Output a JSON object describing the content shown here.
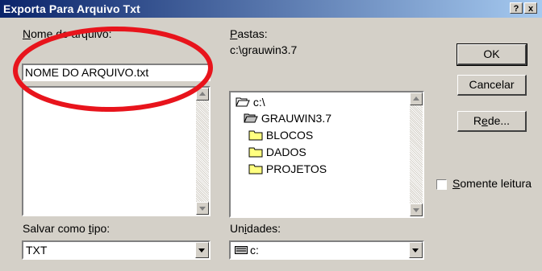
{
  "window": {
    "title": "Exporta Para Arquivo Txt",
    "help_glyph": "?",
    "close_glyph": "x"
  },
  "filename": {
    "label_first": "N",
    "label_rest": "ome do arquivo:",
    "value": "NOME DO ARQUIVO.txt"
  },
  "folders": {
    "label_first": "P",
    "label_rest": "astas:",
    "current_path": "c:\\grauwin3.7",
    "tree": [
      {
        "label": "c:\\",
        "icon": "open-folder-icon"
      },
      {
        "label": "GRAUWIN3.7",
        "icon": "open-folder-icon"
      },
      {
        "label": "BLOCOS",
        "icon": "folder-icon"
      },
      {
        "label": "DADOS",
        "icon": "folder-icon"
      },
      {
        "label": "PROJETOS",
        "icon": "folder-icon"
      }
    ]
  },
  "save_type": {
    "label_pre": "Salvar como ",
    "label_u": "t",
    "label_post": "ipo:",
    "value": "TXT"
  },
  "drives": {
    "label_pre": "Un",
    "label_u": "i",
    "label_post": "dades:",
    "value": "c:",
    "icon": "drive-icon"
  },
  "buttons": {
    "ok": "OK",
    "cancel": "Cancelar",
    "network_pre": "R",
    "network_u": "e",
    "network_post": "de..."
  },
  "readonly": {
    "label_u": "S",
    "label_rest": "omente leitura",
    "checked": false
  },
  "colors": {
    "title_start": "#0a246a",
    "title_end": "#a6caf0",
    "face": "#d4d0c8",
    "annotation": "#e8141c"
  }
}
